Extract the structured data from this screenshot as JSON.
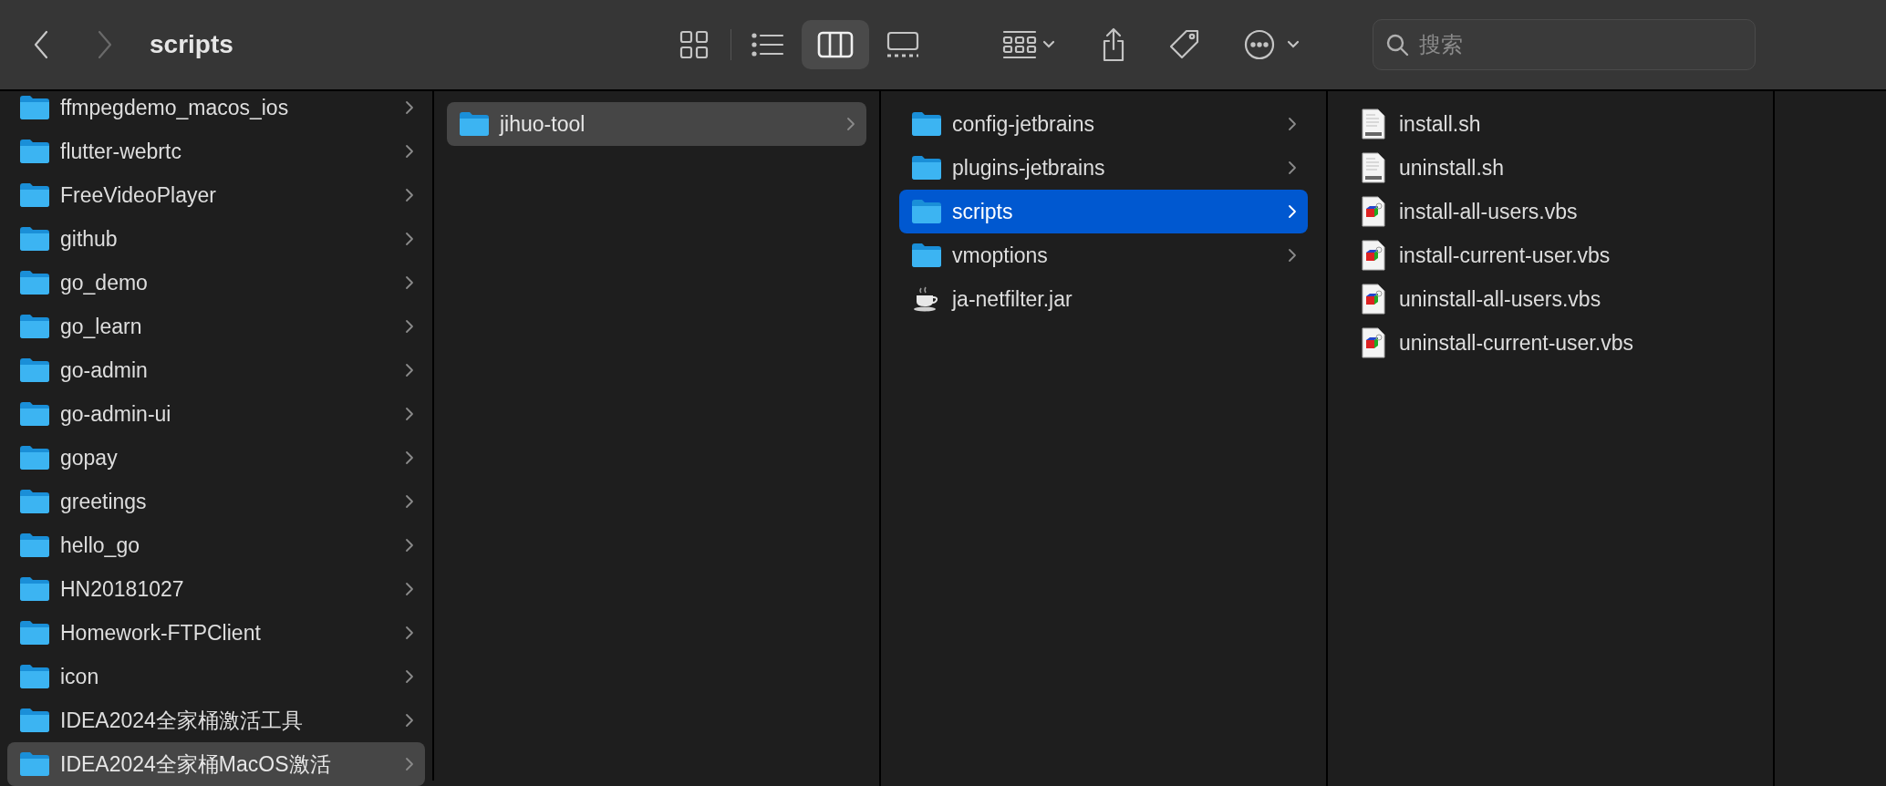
{
  "toolbar": {
    "back": {
      "disabled": false
    },
    "forward": {
      "disabled": true
    },
    "title": "scripts",
    "view_buttons": [
      {
        "kind": "icons",
        "selected": false
      },
      {
        "kind": "list",
        "selected": false
      },
      {
        "kind": "columns",
        "selected": true
      },
      {
        "kind": "gallery",
        "selected": false
      }
    ],
    "search": {
      "placeholder": "搜索"
    }
  },
  "columns": [
    {
      "items": [
        {
          "name": "ffmpegdemo_macos_ios",
          "kind": "folder",
          "selected": false
        },
        {
          "name": "flutter-webrtc",
          "kind": "folder",
          "selected": false
        },
        {
          "name": "FreeVideoPlayer",
          "kind": "folder",
          "selected": false
        },
        {
          "name": "github",
          "kind": "folder",
          "selected": false
        },
        {
          "name": "go_demo",
          "kind": "folder",
          "selected": false
        },
        {
          "name": "go_learn",
          "kind": "folder",
          "selected": false
        },
        {
          "name": "go-admin",
          "kind": "folder",
          "selected": false
        },
        {
          "name": "go-admin-ui",
          "kind": "folder",
          "selected": false
        },
        {
          "name": "gopay",
          "kind": "folder",
          "selected": false
        },
        {
          "name": "greetings",
          "kind": "folder",
          "selected": false
        },
        {
          "name": "hello_go",
          "kind": "folder",
          "selected": false
        },
        {
          "name": "HN20181027",
          "kind": "folder",
          "selected": false
        },
        {
          "name": "Homework-FTPClient",
          "kind": "folder",
          "selected": false
        },
        {
          "name": "icon",
          "kind": "folder",
          "selected": false
        },
        {
          "name": "IDEA2024全家桶激活工具",
          "kind": "folder",
          "selected": false
        },
        {
          "name": "IDEA2024全家桶MacOS激活",
          "kind": "folder",
          "selected": true,
          "focused": false
        }
      ]
    },
    {
      "items": [
        {
          "name": "jihuo-tool",
          "kind": "folder",
          "selected": true,
          "focused": false
        }
      ]
    },
    {
      "items": [
        {
          "name": "config-jetbrains",
          "kind": "folder",
          "selected": false
        },
        {
          "name": "plugins-jetbrains",
          "kind": "folder",
          "selected": false
        },
        {
          "name": "scripts",
          "kind": "folder",
          "selected": true,
          "focused": true
        },
        {
          "name": "vmoptions",
          "kind": "folder",
          "selected": false
        },
        {
          "name": "ja-netfilter.jar",
          "kind": "java",
          "selected": false
        }
      ]
    },
    {
      "items": [
        {
          "name": "install.sh",
          "kind": "shell",
          "selected": false
        },
        {
          "name": "uninstall.sh",
          "kind": "shell",
          "selected": false
        },
        {
          "name": "install-all-users.vbs",
          "kind": "vbs",
          "selected": false
        },
        {
          "name": "install-current-user.vbs",
          "kind": "vbs",
          "selected": false
        },
        {
          "name": "uninstall-all-users.vbs",
          "kind": "vbs",
          "selected": false
        },
        {
          "name": "uninstall-current-user.vbs",
          "kind": "vbs",
          "selected": false
        }
      ]
    }
  ]
}
